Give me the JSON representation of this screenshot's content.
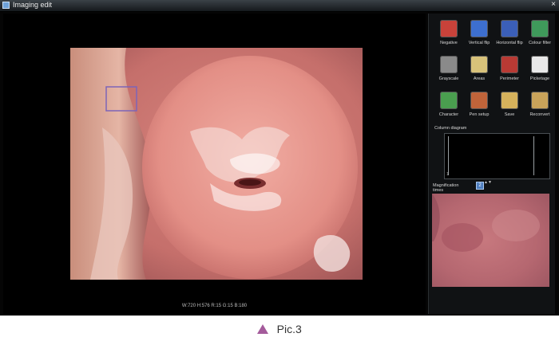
{
  "window": {
    "title": "Imaging edit",
    "close_label": "×"
  },
  "status_bar": {
    "text": "W:720 H:576 R:15 G:15 B:180"
  },
  "tools": [
    {
      "label": "Negative",
      "icon": "negative-icon",
      "color": "#c8423a"
    },
    {
      "label": "Vertical flip",
      "icon": "vertical-flip-icon",
      "color": "#3d6fcf"
    },
    {
      "label": "Horizontal flip",
      "icon": "horizontal-flip-icon",
      "color": "#3b5fb8"
    },
    {
      "label": "Colour filter",
      "icon": "colour-filter-icon",
      "color": "#3f9a5b"
    },
    {
      "label": "Grayscale",
      "icon": "grayscale-icon",
      "color": "#8a8a8a"
    },
    {
      "label": "Areas",
      "icon": "areas-icon",
      "color": "#d8c27a"
    },
    {
      "label": "Perimeter",
      "icon": "perimeter-icon",
      "color": "#b83a34"
    },
    {
      "label": "Picketage",
      "icon": "picketage-icon",
      "color": "#e8e8e8"
    },
    {
      "label": "Character",
      "icon": "character-icon",
      "color": "#4a9e4f"
    },
    {
      "label": "Pen setup",
      "icon": "pen-setup-icon",
      "color": "#c0643a"
    },
    {
      "label": "Save",
      "icon": "save-icon",
      "color": "#d6b25c"
    },
    {
      "label": "Reconvert",
      "icon": "reconvert-icon",
      "color": "#c9a35a"
    }
  ],
  "column_diagram": {
    "title": "Column diagram",
    "axis_tick": "1"
  },
  "magnification": {
    "label": "Magnification times",
    "value": "2",
    "arrows": "▲▼"
  },
  "caption": {
    "text": "Pic.3",
    "marker_color": "#a45b9b"
  }
}
